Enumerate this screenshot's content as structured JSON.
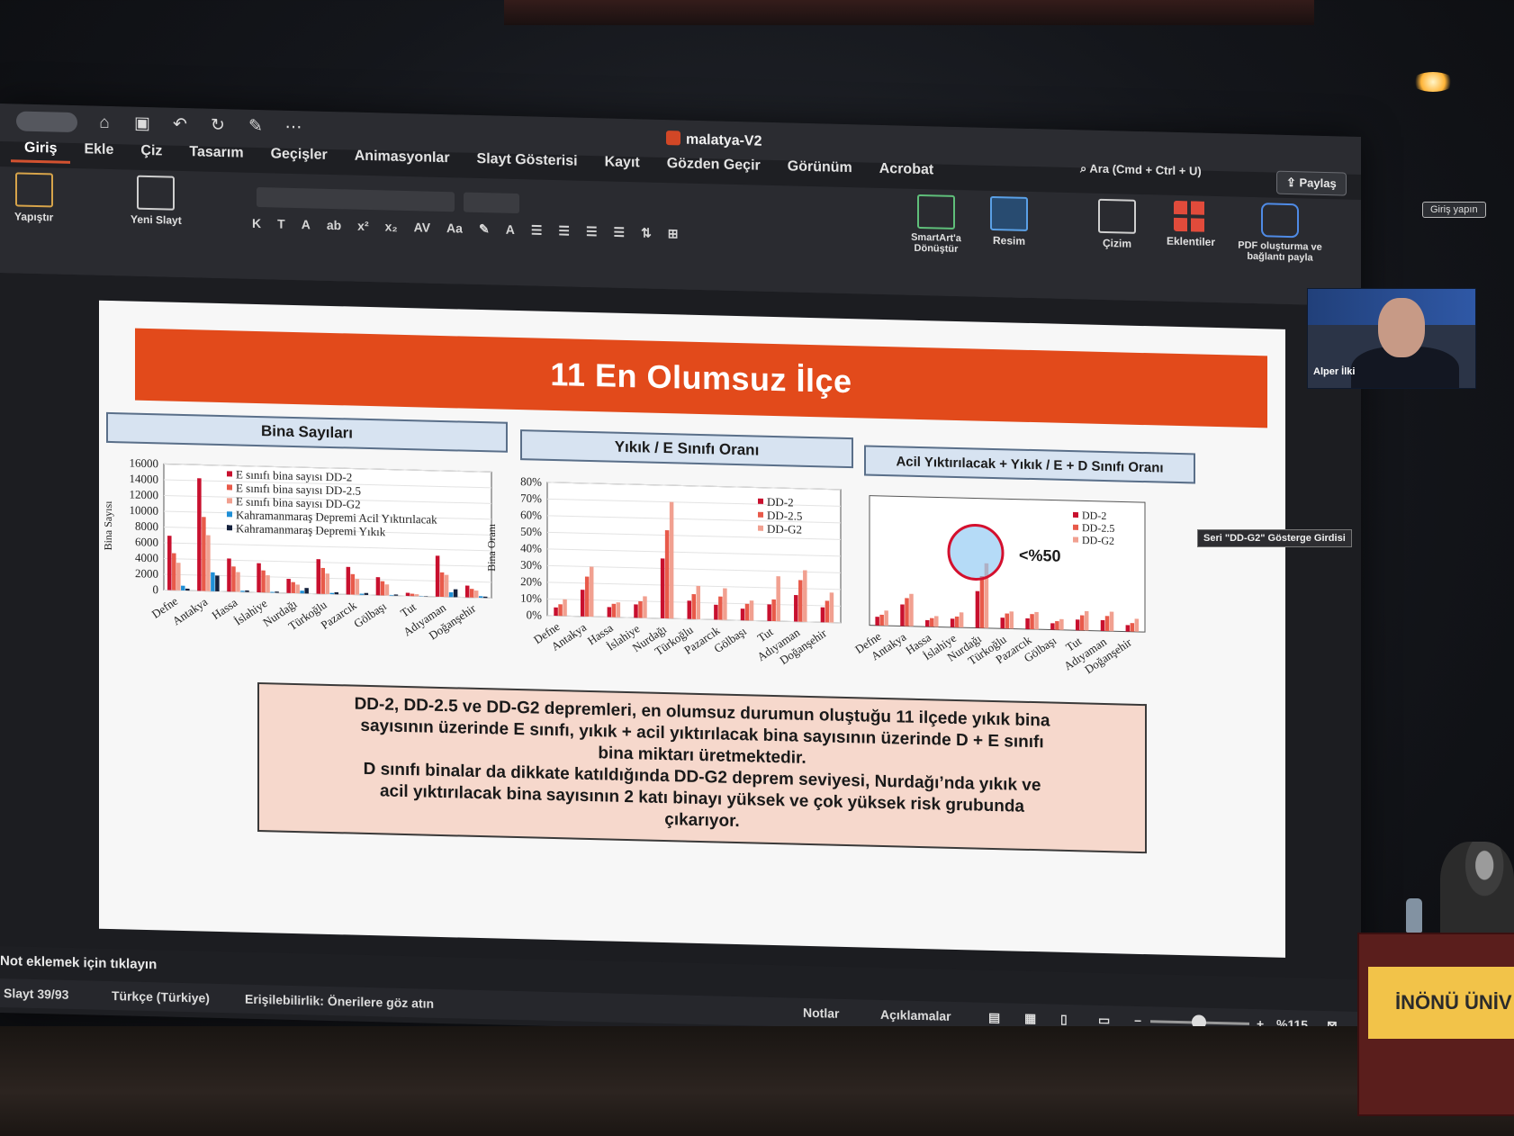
{
  "window": {
    "doc_title": "malatya-V2",
    "search_placeholder": "Ara (Cmd + Ctrl + U)",
    "share_label": "Paylaş",
    "login_label": "Giriş yapın"
  },
  "tabs": [
    "Giriş",
    "Ekle",
    "Çiz",
    "Tasarım",
    "Geçişler",
    "Animasyonlar",
    "Slayt Gösterisi",
    "Kayıt",
    "Gözden Geçir",
    "Görünüm",
    "Acrobat"
  ],
  "ribbon": {
    "paste": "Yapıştır",
    "new_slide": "Yeni Slayt",
    "smartart": "SmartArt'a Dönüştür",
    "picture": "Resim",
    "drawing": "Çizim",
    "addins": "Eklentiler",
    "pdf": "PDF oluşturma ve bağlantı payla"
  },
  "slide": {
    "title": "11 En Olumsuz İlçe",
    "panels": [
      "Bina Sayıları",
      "Yıkık / E Sınıfı Oranı",
      "Acil Yıktırılacak + Yıkık / E + D Sınıfı Oranı"
    ],
    "annotation": "<%50",
    "summary": [
      "DD-2, DD-2.5 ve DD-G2 depremleri, en olumsuz durumun oluştuğu 11 ilçede yıkık bina",
      "sayısının üzerinde E sınıfı, yıkık + acil yıktırılacak bina sayısının üzerinde D + E sınıfı",
      "bina miktarı üretmektedir.",
      "D sınıfı binalar da dikkate katıldığında DD-G2 deprem seviyesi, Nurdağı’nda yıkık ve",
      "acil yıktırılacak bina sayısının 2 katı binayı yüksek ve çok yüksek risk grubunda",
      "çıkarıyor."
    ]
  },
  "tooltip": "Seri \"DD-G2\" Gösterge Girdisi",
  "webcam_name": "Alper İlki",
  "notes_placeholder": "Not eklemek için tıklayın",
  "status": {
    "slide": "Slayt 39/93",
    "language": "Türkçe (Türkiye)",
    "accessibility": "Erişilebilirlik: Önerilere göz atın",
    "notes": "Notlar",
    "comments": "Açıklamalar",
    "zoom": "%115"
  },
  "colors": {
    "dd2": "#c8102e",
    "dd25": "#e85a4a",
    "ddg2": "#f1a090",
    "acil": "#1f8fd6",
    "yikik": "#14213d",
    "title_bg": "#e24a1b",
    "summary_bg": "#f6d8cc"
  },
  "chart_data": [
    {
      "type": "bar",
      "title": "Bina Sayıları",
      "ylabel": "Bina Sayısı",
      "ylim": [
        0,
        16000
      ],
      "yticks": [
        "0",
        "2000",
        "4000",
        "6000",
        "8000",
        "10000",
        "12000",
        "14000",
        "16000"
      ],
      "categories": [
        "Defne",
        "Antakya",
        "Hassa",
        "İslahiye",
        "Nurdağı",
        "Türkoğlu",
        "Pazarcık",
        "Gölbaşı",
        "Tut",
        "Adıyaman",
        "Doğanşehir"
      ],
      "series": [
        {
          "name": "E sınıfı bina sayısı DD-2",
          "color": "#c8102e",
          "values": [
            6900,
            14300,
            4200,
            3700,
            1800,
            4400,
            3500,
            2300,
            400,
            5200,
            1500
          ]
        },
        {
          "name": "E sınıfı bina sayısı DD-2.5",
          "color": "#e85a4a",
          "values": [
            4700,
            9400,
            3200,
            2800,
            1400,
            3300,
            2600,
            1800,
            300,
            3100,
            1100
          ]
        },
        {
          "name": "E sınıfı bina sayısı DD-G2",
          "color": "#f1a090",
          "values": [
            3500,
            7100,
            2500,
            2200,
            1100,
            2600,
            2000,
            1400,
            250,
            2800,
            900
          ]
        },
        {
          "name": "Kahramanmaraş Depremi Acil Yıktırılacak",
          "color": "#1f8fd6",
          "values": [
            600,
            2400,
            150,
            100,
            350,
            150,
            150,
            80,
            40,
            600,
            200
          ]
        },
        {
          "name": "Kahramanmaraş Depremi Yıkık",
          "color": "#14213d",
          "values": [
            250,
            2000,
            200,
            150,
            700,
            250,
            250,
            150,
            50,
            1000,
            150
          ]
        }
      ]
    },
    {
      "type": "bar",
      "title": "Yıkık / E Sınıfı Oranı",
      "ylabel": "Bina Oranı",
      "ylim": [
        0,
        80
      ],
      "yticks": [
        "0%",
        "10%",
        "20%",
        "30%",
        "40%",
        "50%",
        "60%",
        "70%",
        "80%"
      ],
      "categories": [
        "Defne",
        "Antakya",
        "Hassa",
        "İslahiye",
        "Nurdağı",
        "Türkoğlu",
        "Pazarcık",
        "Gölbaşı",
        "Tut",
        "Adıyaman",
        "Doğanşehir"
      ],
      "series": [
        {
          "name": "DD-2",
          "color": "#c8102e",
          "values": [
            5,
            16,
            6,
            8,
            36,
            11,
            9,
            7,
            10,
            16,
            9
          ]
        },
        {
          "name": "DD-2.5",
          "color": "#e85a4a",
          "values": [
            7,
            24,
            8,
            10,
            53,
            15,
            14,
            10,
            13,
            25,
            13
          ]
        },
        {
          "name": "DD-G2",
          "color": "#f1a090",
          "values": [
            10,
            30,
            9,
            13,
            70,
            20,
            19,
            12,
            27,
            31,
            18
          ]
        }
      ]
    },
    {
      "type": "bar",
      "title": "Acil Yıktırılacak + Yıkık / E + D Sınıfı Oranı",
      "annotation": "<%50",
      "categories": [
        "Defne",
        "Antakya",
        "Hassa",
        "İslahiye",
        "Nurdağı",
        "Türkoğlu",
        "Pazarcık",
        "Gölbaşı",
        "Tut",
        "Adıyaman",
        "Doğanşehir"
      ],
      "series": [
        {
          "name": "DD-2",
          "color": "#c8102e",
          "values": [
            4,
            10,
            3,
            4,
            17,
            5,
            5,
            3,
            5,
            5,
            3
          ]
        },
        {
          "name": "DD-2.5",
          "color": "#e85a4a",
          "values": [
            5,
            13,
            4,
            5,
            24,
            7,
            7,
            4,
            7,
            7,
            4
          ]
        },
        {
          "name": "DD-G2",
          "color": "#f1a090",
          "values": [
            7,
            15,
            5,
            7,
            30,
            8,
            8,
            5,
            9,
            9,
            6
          ]
        }
      ]
    }
  ]
}
